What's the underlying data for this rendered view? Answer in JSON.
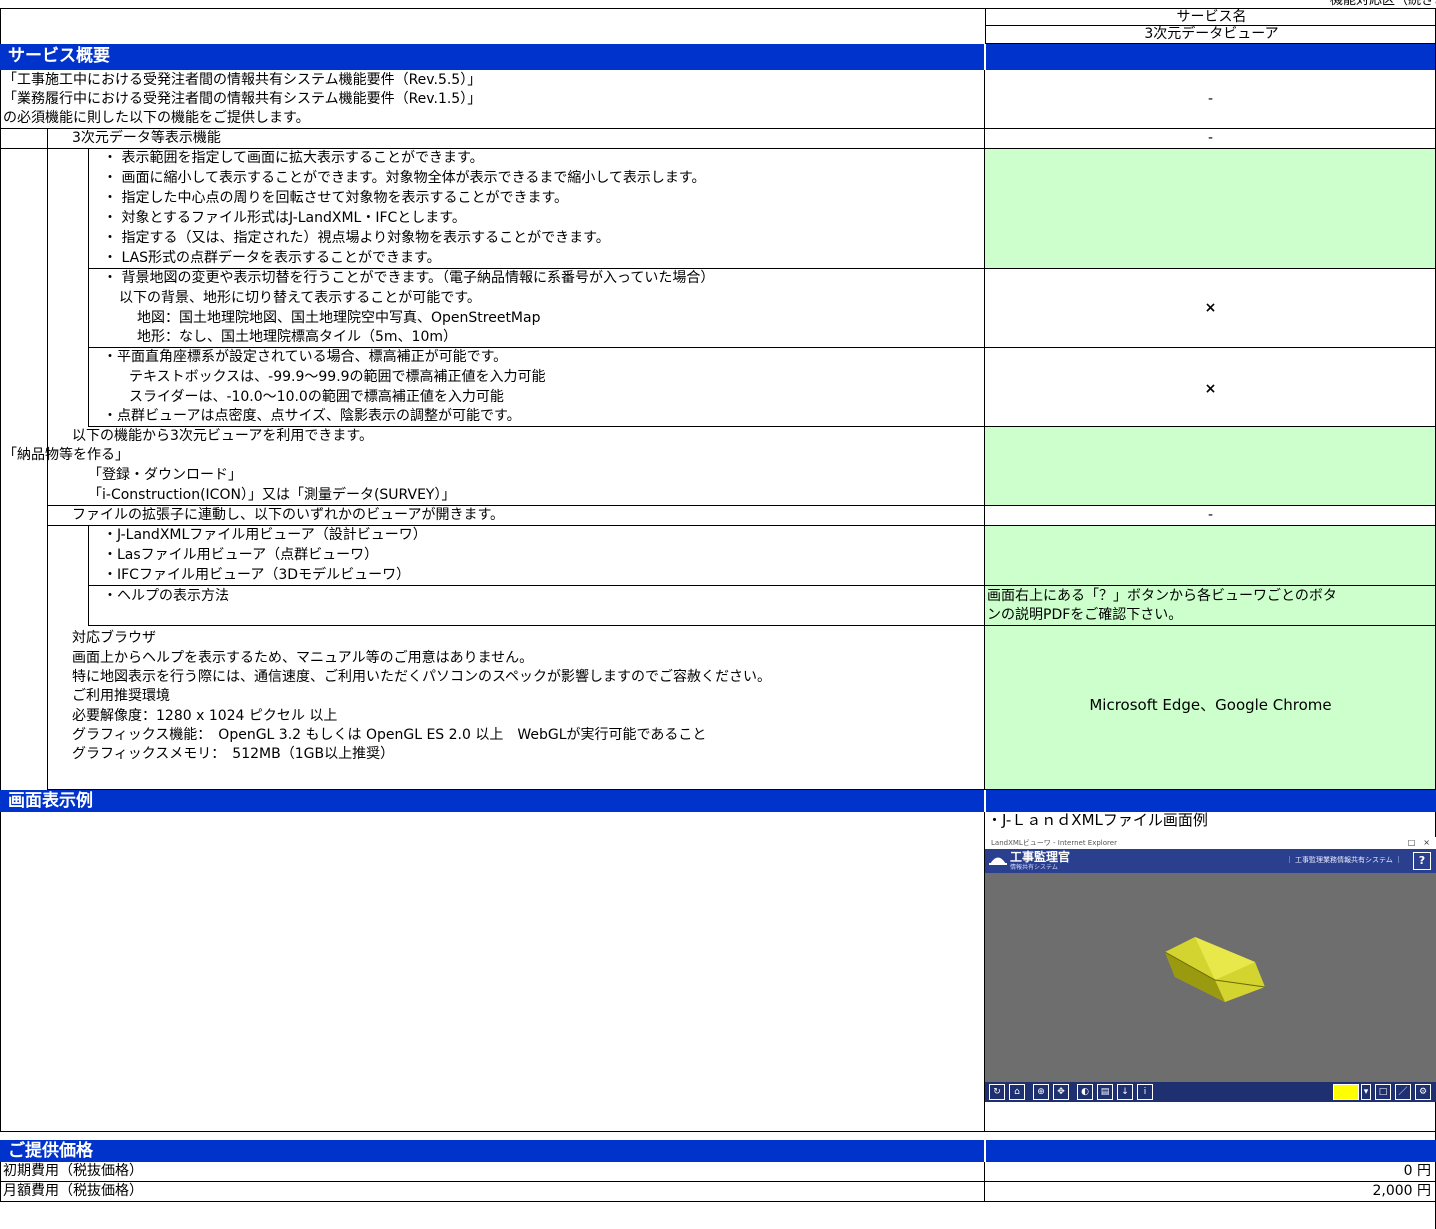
{
  "header": {
    "top_right_note": "機能対応区（続きより）",
    "service_name_label": "サービス名",
    "service_name_value": "3次元データビューア"
  },
  "sections": {
    "overview": "サービス概要",
    "screen_example": "画面表示例",
    "pricing": "ご提供価格"
  },
  "overview": {
    "intro": [
      "「工事施工中における受発注者間の情報共有システム機能要件（Rev.5.5）」",
      "「業務履行中における受発注者間の情報共有システム機能要件（Rev.1.5）」",
      "の必須機能に則した以下の機能をご提供します。"
    ],
    "intro_value": "-",
    "group1_title": "3次元データ等表示機能",
    "group1_value": "-",
    "block_a": [
      "・ 表示範囲を指定して画面に拡大表示することができます。",
      "・ 画面に縮小して表示することができます。対象物全体が表示できるまで縮小して表示します。",
      "・ 指定した中心点の周りを回転させて対象物を表示することができます。",
      "・ 対象とするファイル形式はJ-LandXML・IFCとします。",
      "・ 指定する（又は、指定された）視点場より対象物を表示することができます。",
      "・ LAS形式の点群データを表示することができます。"
    ],
    "block_b": [
      "・ 背景地図の変更や表示切替を行うことができます。（電子納品情報に系番号が入っていた場合）",
      "以下の背景、地形に切り替えて表示することが可能です。",
      "地図：国土地理院地図、国土地理院空中写真、OpenStreetMap",
      "地形：なし、国土地理院標高タイル（5m、10m）"
    ],
    "block_b_value": "×",
    "block_c": [
      "・平面直角座標系が設定されている場合、標高補正が可能です。",
      "テキストボックスは、-99.9～99.9の範囲で標高補正値を入力可能",
      "スライダーは、-10.0～10.0の範囲で標高補正値を入力可能",
      "・点群ビューアは点密度、点サイズ、陰影表示の調整が可能です。"
    ],
    "block_c_value": "×",
    "usage": [
      "以下の機能から3次元ビューアを利用できます。",
      "「納品物等を作る」",
      "「登録・ダウンロード」",
      "「i-Construction(ICON）」又は「測量データ(SURVEY）」"
    ],
    "ext_title": "ファイルの拡張子に連動し、以下のいずれかのビューアが開きます。",
    "ext_value": "-",
    "viewers": [
      "・J-LandXMLファイル用ビューア（設計ビューワ）",
      "・Lasファイル用ビューア（点群ビューワ）",
      "・IFCファイル用ビューア（3Dモデルビューワ）"
    ],
    "help_label": "・ヘルプの表示方法",
    "help_value": [
      "画面右上にある「？」ボタンから各ビューワごとのボタ",
      "ンの説明PDFをご確認下さい。"
    ],
    "env": [
      "対応ブラウザ",
      "画面上からヘルプを表示するため、マニュアル等のご用意はありません。",
      "特に地図表示を行う際には、通信速度、ご利用いただくパソコンのスペックが影響しますのでご容赦ください。",
      "ご利用推奨環境",
      "必要解像度：1280 x 1024 ピクセル 以上",
      "グラフィックス機能：　OpenGL 3.2 もしくは OpenGL ES 2.0 以上　WebGLが実行可能であること",
      "グラフィックスメモリ：　512MB（1GB以上推奨）"
    ],
    "browsers": "Microsoft Edge、Google Chrome"
  },
  "screen_example": {
    "caption": "・J-ＬａｎｄXMLファイル画面例",
    "screenshot": {
      "window_title": "LandXMLビューワ - Internet Explorer",
      "window_controls": "□　×",
      "app_name": "工事監理官",
      "app_sub": "情報共有システム",
      "app_info": "｜ 工事監理業務情報共有システム ｜",
      "help_button": "?",
      "highlight_color": "#ffff00",
      "toolbar_icons": [
        "rotate-icon",
        "home-icon",
        "zoom-icon",
        "pan-icon",
        "view-icon",
        "layer-icon",
        "download-icon",
        "info-icon"
      ],
      "right_tools": [
        "color-picker",
        "square-tool",
        "line-tool",
        "settings-tool"
      ]
    }
  },
  "pricing": {
    "initial_label": "初期費用（税抜価格）",
    "initial_value": "0 円",
    "monthly_label": "月額費用（税抜価格）",
    "monthly_value": "2,000 円"
  }
}
